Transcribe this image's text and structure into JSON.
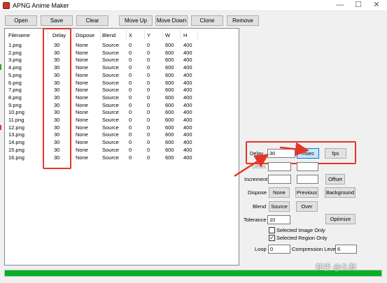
{
  "window": {
    "title": "APNG Anime Maker",
    "minimize": "—",
    "maximize": "☐",
    "close": "✕"
  },
  "toolbar": {
    "open": "Open",
    "save": "Save",
    "clear": "Clear",
    "move_up": "Move Up",
    "move_down": "Move Down",
    "clone": "Clone",
    "remove": "Remove"
  },
  "frame_list": {
    "columns": [
      "Filename",
      "Delay",
      "Dispose",
      "Blend",
      "X",
      "Y",
      "W",
      "H"
    ],
    "rows": [
      [
        "1.png",
        "30",
        "None",
        "Source",
        "0",
        "0",
        "600",
        "400"
      ],
      [
        "2.png",
        "30",
        "None",
        "Source",
        "0",
        "0",
        "600",
        "400"
      ],
      [
        "3.png",
        "30",
        "None",
        "Source",
        "0",
        "0",
        "600",
        "400"
      ],
      [
        "4.png",
        "30",
        "None",
        "Source",
        "0",
        "0",
        "600",
        "400"
      ],
      [
        "5.png",
        "30",
        "None",
        "Source",
        "0",
        "0",
        "600",
        "400"
      ],
      [
        "6.png",
        "30",
        "None",
        "Source",
        "0",
        "0",
        "600",
        "400"
      ],
      [
        "7.png",
        "30",
        "None",
        "Source",
        "0",
        "0",
        "600",
        "400"
      ],
      [
        "8.png",
        "30",
        "None",
        "Source",
        "0",
        "0",
        "600",
        "400"
      ],
      [
        "9.png",
        "30",
        "None",
        "Source",
        "0",
        "0",
        "600",
        "400"
      ],
      [
        "10.png",
        "30",
        "None",
        "Source",
        "0",
        "0",
        "600",
        "400"
      ],
      [
        "11.png",
        "30",
        "None",
        "Source",
        "0",
        "0",
        "600",
        "400"
      ],
      [
        "12.png",
        "30",
        "None",
        "Source",
        "0",
        "0",
        "600",
        "400"
      ],
      [
        "13.png",
        "30",
        "None",
        "Source",
        "0",
        "0",
        "600",
        "400"
      ],
      [
        "14.png",
        "30",
        "None",
        "Source",
        "0",
        "0",
        "600",
        "400"
      ],
      [
        "15.png",
        "30",
        "None",
        "Source",
        "0",
        "0",
        "600",
        "400"
      ],
      [
        "16.png",
        "30",
        "None",
        "Source",
        "0",
        "0",
        "600",
        "400"
      ]
    ]
  },
  "settings": {
    "delay_label": "Delay",
    "delay_value": "30",
    "msec": "msec",
    "fps": "fps",
    "offset_label": "Offset",
    "offset_x": "",
    "offset_y": "",
    "increment_label": "Increment",
    "increment_x": "",
    "increment_y": "",
    "offset_button": "Offset",
    "dispose_label": "Dispose",
    "dispose_none": "None",
    "dispose_previous": "Previous",
    "dispose_background": "Background",
    "blend_label": "Blend",
    "blend_source": "Source",
    "blend_over": "Over",
    "tolerance_label": "Tolerance",
    "tolerance_value": "10",
    "optimize": "Optimize",
    "selected_image_only": "Selected Image Only",
    "selected_image_only_checked": false,
    "selected_region_only": "Selected Region Only",
    "selected_region_only_checked": true,
    "loop_label": "Loop",
    "loop_value": "0",
    "compression_label": "Compression Level",
    "compression_value": "6"
  },
  "progress": {
    "value": 1.0
  },
  "watermark": "知乎 @久鲜",
  "colors": {
    "annotation_red": "#e3362b",
    "progress_green": "#06b025",
    "msec_active": "#cce4f7"
  }
}
